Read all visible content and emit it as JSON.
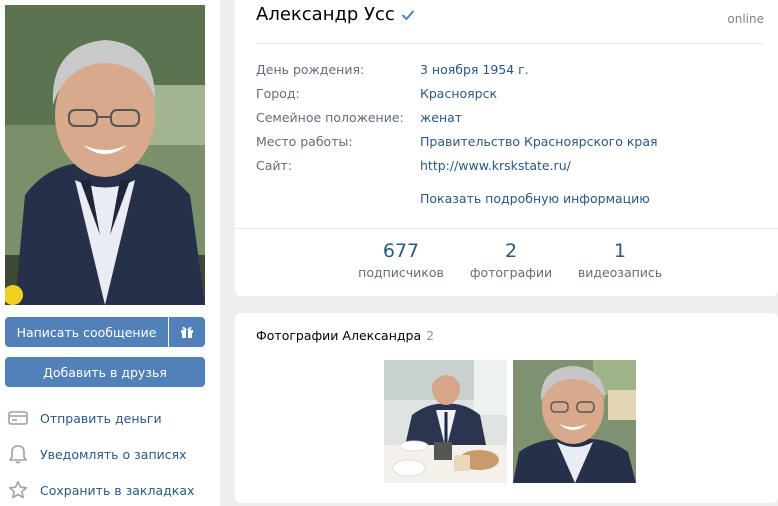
{
  "profile": {
    "name": "Александр Усс",
    "status": "online",
    "verified_icon": "checkmark-icon",
    "info": [
      {
        "label": "День рождения:",
        "value": "3 ноября 1954 г."
      },
      {
        "label": "Город:",
        "value": "Красноярск"
      },
      {
        "label": "Семейное положение:",
        "value": "женат"
      },
      {
        "label": "Место работы:",
        "value": "Правительство Красноярского края"
      },
      {
        "label": "Сайт:",
        "value": "http://www.krskstate.ru/"
      }
    ],
    "more_link": "Показать подробную информацию",
    "counters": [
      {
        "num": "677",
        "label": "подписчиков"
      },
      {
        "num": "2",
        "label": "фотографии"
      },
      {
        "num": "1",
        "label": "видеозапись"
      }
    ]
  },
  "actions": {
    "message": "Написать сообщение",
    "gift_icon": "gift-icon",
    "add_friend": "Добавить в друзья",
    "links": [
      {
        "icon": "card-icon",
        "label": "Отправить деньги"
      },
      {
        "icon": "bell-icon",
        "label": "Уведомлять о записях"
      },
      {
        "icon": "star-icon",
        "label": "Сохранить в закладках"
      }
    ]
  },
  "photos": {
    "title": "Фотографии Александра",
    "count": "2"
  },
  "colors": {
    "accent": "#5181b8",
    "link": "#2a5885",
    "muted": "#626d7a",
    "background": "#edeef0"
  }
}
